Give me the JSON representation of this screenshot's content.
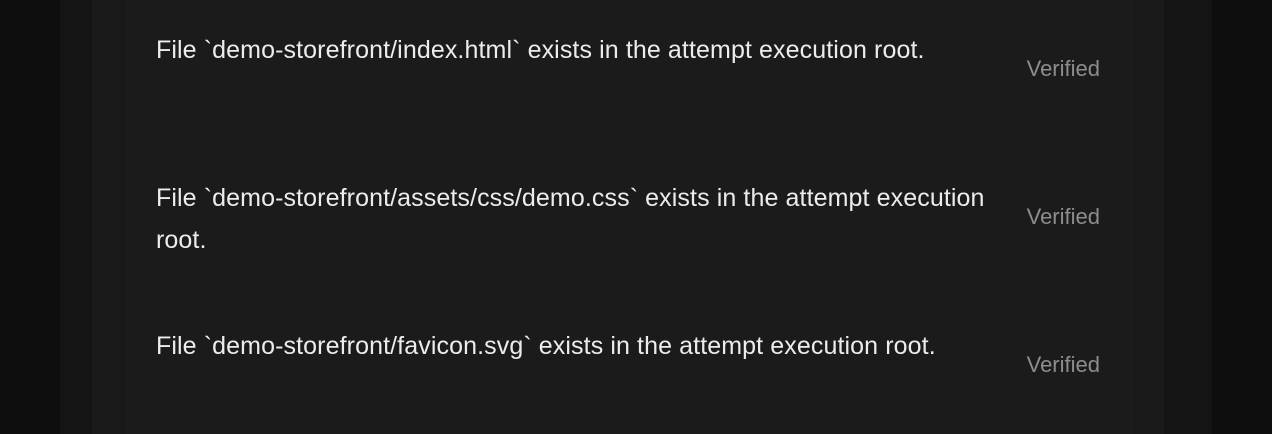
{
  "checks": [
    {
      "text": "File `demo-storefront/index.html` exists in the attempt execution root.",
      "status": "Verified"
    },
    {
      "text": "File `demo-storefront/assets/css/demo.css` exists in the attempt execution root.",
      "status": "Verified"
    },
    {
      "text": "File `demo-storefront/favicon.svg` exists in the attempt execution root.",
      "status": "Verified"
    }
  ]
}
